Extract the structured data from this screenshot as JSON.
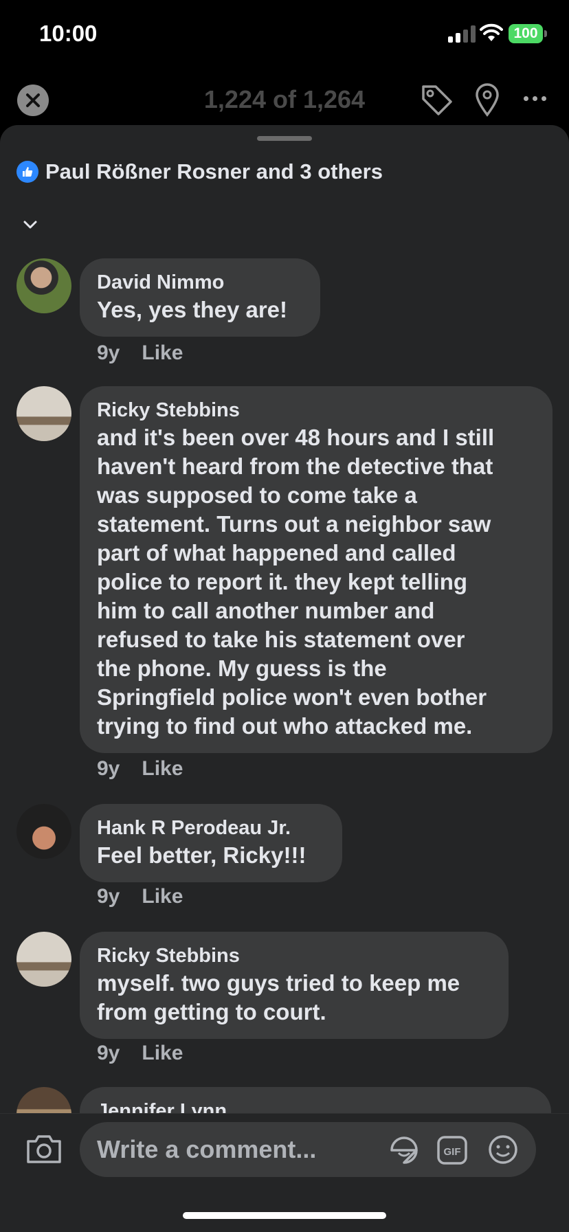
{
  "status_bar": {
    "time": "10:00",
    "battery": "100"
  },
  "viewer": {
    "counter": "1,224 of 1,264"
  },
  "reactions": {
    "summary": "Paul Rößner Rosner and 3 others"
  },
  "comments": [
    {
      "author": "David Nimmo",
      "lines": [
        "Yes, yes they are!"
      ],
      "age": "9y",
      "action": "Like"
    },
    {
      "author": "Ricky Stebbins",
      "lines": [
        "and it's been over 48 hours and I still",
        "haven't heard from the detective that",
        "was supposed to come take a",
        "statement. Turns out a neighbor saw",
        "part of what happened and called",
        "police to report it. they kept telling",
        "him to call another number and",
        "refused to take his statement over",
        "the phone. My guess is the",
        "Springfield police won't even bother",
        "trying to find out who attacked me."
      ],
      "age": "9y",
      "action": "Like"
    },
    {
      "author": "Hank R Perodeau Jr.",
      "lines": [
        "Feel better, Ricky!!!"
      ],
      "age": "9y",
      "action": "Like"
    },
    {
      "author": "Ricky Stebbins",
      "lines": [
        "myself. two guys tried to keep me",
        "from getting to court."
      ],
      "age": "9y",
      "action": "Like"
    },
    {
      "author": "Jennifer Lynn"
    }
  ],
  "composer": {
    "placeholder": "Write a comment..."
  },
  "icons": {
    "close": "close-icon",
    "tag": "tag-icon",
    "location": "location-pin-icon",
    "more": "more-icon",
    "like": "thumbs-up-icon",
    "chevron": "chevron-down-icon",
    "camera": "camera-icon",
    "sticker": "sticker-icon",
    "gif": "gif-icon",
    "emoji": "emoji-icon"
  },
  "colors": {
    "accent": "#2d88ff",
    "sheet": "#242526",
    "bubble": "#3a3b3c",
    "battery": "#4cd964"
  }
}
